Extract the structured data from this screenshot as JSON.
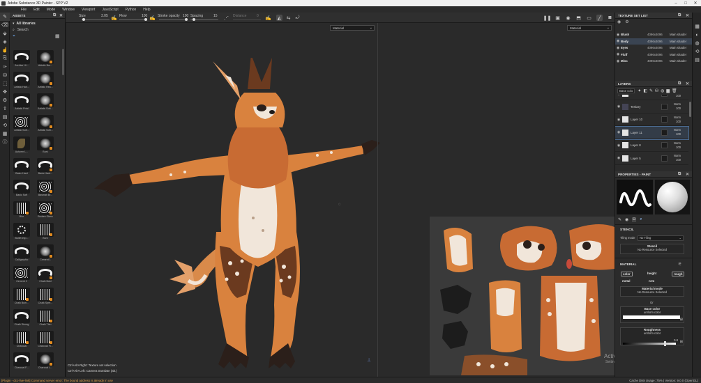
{
  "window": {
    "title": "Adobe Substance 3D Painter - SPP V2"
  },
  "menu": [
    "File",
    "Edit",
    "Mode",
    "Window",
    "Viewport",
    "JavaScript",
    "Python",
    "Help"
  ],
  "toolbar": {
    "size_label": "Size",
    "size_value": "3.05",
    "flow_label": "Flow",
    "flow_value": "100",
    "stroke_label": "Stroke opacity",
    "stroke_value": "100",
    "spacing_label": "Spacing",
    "spacing_value": "15",
    "distance_label": "Distance",
    "distance_value": "0"
  },
  "assets": {
    "title": "ASSETS",
    "library": "All libraries",
    "search_placeholder": "Search",
    "items": [
      {
        "label": "Archive Hi...",
        "kind": "stroke"
      },
      {
        "label": "Artistic Bru...",
        "kind": "soft"
      },
      {
        "label": "Artistic Hair...",
        "kind": "stroke"
      },
      {
        "label": "Artistic Hea...",
        "kind": "soft"
      },
      {
        "label": "Artistic Print",
        "kind": "stroke"
      },
      {
        "label": "Artistic Soft...",
        "kind": "soft"
      },
      {
        "label": "Artistic Soft...",
        "kind": "dots"
      },
      {
        "label": "Artistic Soft...",
        "kind": "soft"
      },
      {
        "label": "Autumn L...",
        "kind": "leaf"
      },
      {
        "label": "Bark",
        "kind": "soft"
      },
      {
        "label": "Basic Hard",
        "kind": "stroke"
      },
      {
        "label": "Basic Hard...",
        "kind": "stroke"
      },
      {
        "label": "Basic Soft",
        "kind": "stroke"
      },
      {
        "label": "Basmati Br...",
        "kind": "dots"
      },
      {
        "label": "Blur",
        "kind": "spikes"
      },
      {
        "label": "Broken Glass",
        "kind": "dots"
      },
      {
        "label": "Bullet Imp...",
        "kind": "ring"
      },
      {
        "label": "Burn",
        "kind": "spikes"
      },
      {
        "label": "Calligraphic",
        "kind": "stroke"
      },
      {
        "label": "Cement 1",
        "kind": "soft"
      },
      {
        "label": "Cement 2",
        "kind": "dots"
      },
      {
        "label": "Chalk Bold",
        "kind": "stroke"
      },
      {
        "label": "Chalk Bum...",
        "kind": "spikes"
      },
      {
        "label": "Chalk Spre...",
        "kind": "spikes"
      },
      {
        "label": "Chalk Strong",
        "kind": "stroke"
      },
      {
        "label": "Chalk Thin",
        "kind": "spikes"
      },
      {
        "label": "Charcoal",
        "kind": "spikes"
      },
      {
        "label": "Charcoal Fi...",
        "kind": "spikes"
      },
      {
        "label": "Charcoal F...",
        "kind": "stroke"
      },
      {
        "label": "Charcoal L...",
        "kind": "soft"
      }
    ]
  },
  "viewport": {
    "left_dropdown": "Material",
    "right_dropdown": "Material",
    "hint_1": "Ctrl+Alt+Right: Texture set selection",
    "hint_2": "Ctrl+Alt+Left: Camera translate (alt.)",
    "watermark_title": "Activate Windows",
    "watermark_sub": "Settings to activate Windows."
  },
  "texture_set_list": {
    "title": "TEXTURE SET LIST",
    "rows": [
      {
        "name": "Blush",
        "resolution": "4096x4096",
        "shader": "Main shader"
      },
      {
        "name": "Body",
        "resolution": "4096x4096",
        "shader": "Main shader",
        "selected": true
      },
      {
        "name": "Eyes",
        "resolution": "4096x4096",
        "shader": "Main shader"
      },
      {
        "name": "Fluff",
        "resolution": "4096x4096",
        "shader": "Main shader"
      },
      {
        "name": "Misc",
        "resolution": "4096x4096",
        "shader": "Main shader"
      }
    ]
  },
  "layers": {
    "title": "LAYERS",
    "channel": "Base colo",
    "rows": [
      {
        "name": "",
        "blend": "",
        "opacity": "100",
        "partial": true
      },
      {
        "name": "Tertiary",
        "blend": "Norm",
        "opacity": "100",
        "folder": true
      },
      {
        "name": "Layer 10",
        "blend": "Norm",
        "opacity": "100"
      },
      {
        "name": "Layer 11",
        "blend": "Norm",
        "opacity": "100",
        "selected": true
      },
      {
        "name": "Layer 8",
        "blend": "Norm",
        "opacity": "100"
      },
      {
        "name": "Layer 5",
        "blend": "Norm",
        "opacity": "100"
      }
    ]
  },
  "properties": {
    "title": "PROPERTIES - PAINT",
    "stencil_header": "STENCIL",
    "tiling_label": "Tiling mode",
    "tiling_value": "No Tiling",
    "stencil_label": "Stencil",
    "stencil_value": "No Resource Selected",
    "material_header": "MATERIAL",
    "channels": [
      "color",
      "height",
      "rough",
      "metal",
      "nrm"
    ],
    "material_mode_label": "Material mode",
    "material_mode_value": "No Resource Selected",
    "or_text": "Or",
    "base_color_label": "Base color",
    "base_color_value": "uniform color",
    "roughness_label": "Roughness",
    "roughness_value": "uniform color",
    "roughness_number": "0.8",
    "roughness_fraction": 0.8
  },
  "status": {
    "error": "[Plugin - dcc-live-link] Command server error: The bound address is already in use",
    "right": "Cache Disk Usage:   75% | Version: 9.0.0 (OpenGL)"
  },
  "colors": {
    "accent": "#e08a1e",
    "fur_orange": "#d9823e",
    "fur_brown": "#6b3a1f",
    "fur_cream": "#f1e6da"
  }
}
